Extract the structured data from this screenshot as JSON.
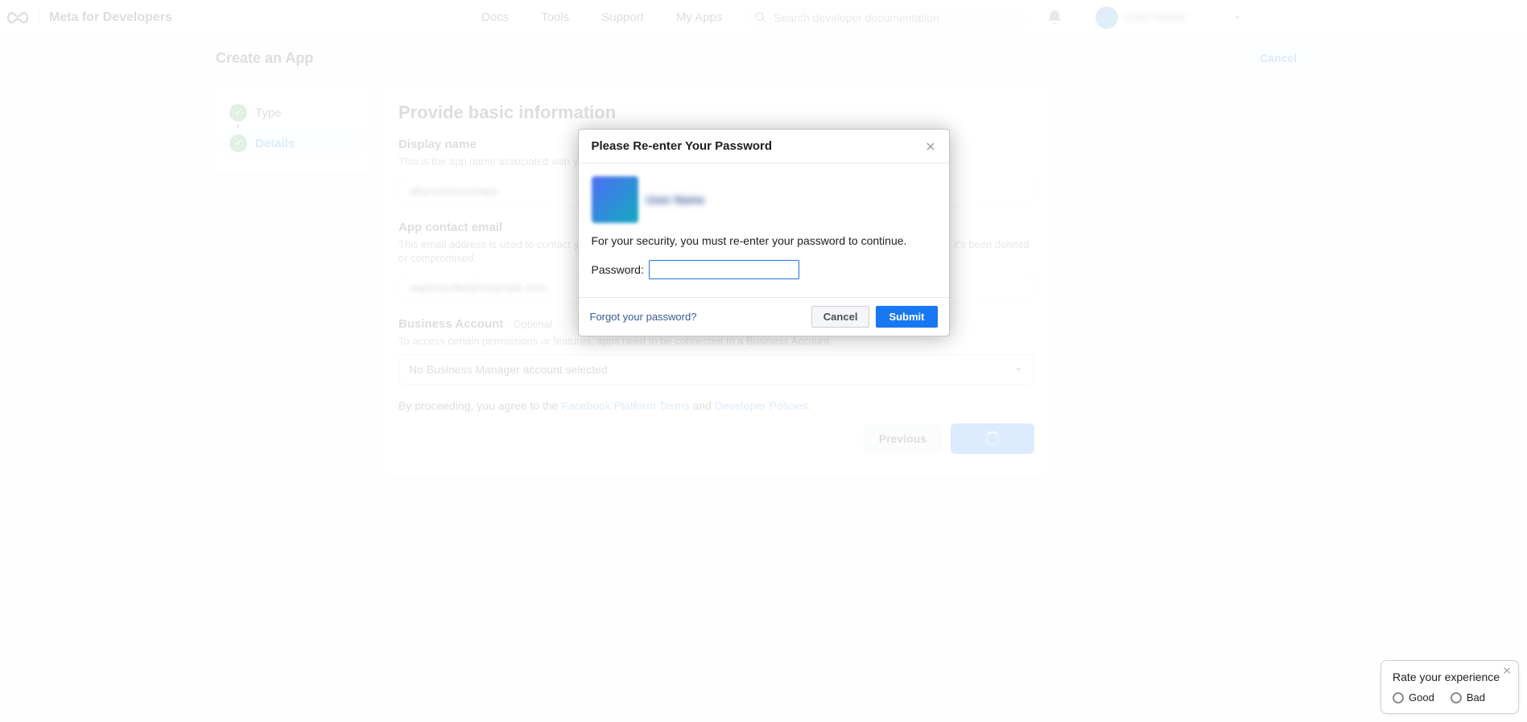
{
  "topnav": {
    "logo_text": "Meta for Developers",
    "links": {
      "docs": "Docs",
      "tools": "Tools",
      "support": "Support",
      "my_apps": "My Apps"
    },
    "search_placeholder": "Search developer documentation",
    "profile_name": "User Name"
  },
  "page": {
    "header_title": "Create an App",
    "cancel_label": "Cancel"
  },
  "sidebar": {
    "steps": [
      {
        "label": "Type"
      },
      {
        "label": "Details"
      }
    ]
  },
  "content": {
    "heading": "Provide basic information",
    "display_name": {
      "label": "Display name",
      "help": "This is the app name associated with your app ID. You can change this later.",
      "value": "aftersomecoolapp"
    },
    "contact_email": {
      "label": "App contact email",
      "help": "This email address is used to contact you about potential policy violations, app restrictions or steps to recover the app if it's been deleted or compromised.",
      "value": "napitravellel@example.com"
    },
    "business": {
      "label": "Business Account",
      "optional": "· Optional",
      "help": "To access certain permissions or features, apps need to be connected to a Business Account.",
      "selected": "No Business Manager account selected"
    },
    "agree_prefix": "By proceeding, you agree to the ",
    "agree_link1": "Facebook Platform Terms",
    "agree_mid": " and ",
    "agree_link2": "Developer Policies.",
    "previous_label": "Previous"
  },
  "modal": {
    "title": "Please Re-enter Your Password",
    "user_name": "User Name",
    "message": "For your security, you must re-enter your password to continue.",
    "password_label": "Password:",
    "password_value": "",
    "forgot": "Forgot your password?",
    "cancel": "Cancel",
    "submit": "Submit"
  },
  "feedback": {
    "title": "Rate your experience",
    "good": "Good",
    "bad": "Bad"
  }
}
